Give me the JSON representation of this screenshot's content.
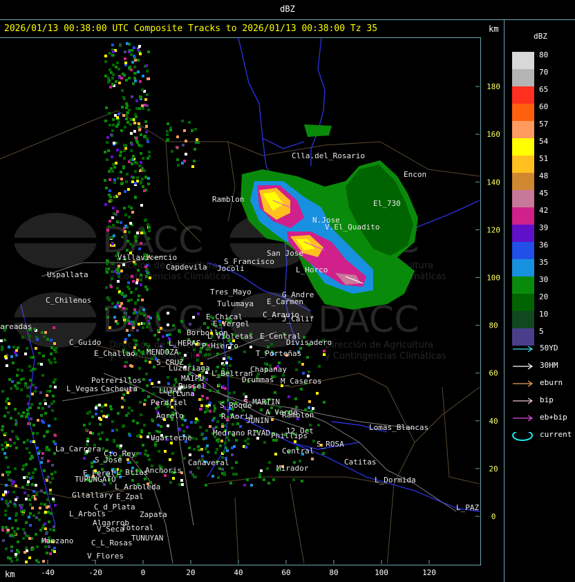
{
  "header": {
    "title": "dBZ"
  },
  "headline": "2026/01/13 00:38:00 UTC Composite Tracks to 2026/01/13 00:38:00 Tz 35",
  "units": {
    "km_top": "km",
    "km_bottom": "km"
  },
  "axes": {
    "x_ticks": [
      "-40",
      "-20",
      "0",
      "20",
      "40",
      "60",
      "80",
      "100",
      "120"
    ],
    "y_ticks": [
      "180",
      "160",
      "140",
      "120",
      "100",
      "80",
      "60",
      "40",
      "20",
      "0"
    ]
  },
  "legend": {
    "title": "dBZ",
    "bins": [
      {
        "label": "80",
        "color": "#d8d8d8"
      },
      {
        "label": "70",
        "color": "#b4b4b4"
      },
      {
        "label": "65",
        "color": "#ff3020"
      },
      {
        "label": "60",
        "color": "#ff6010"
      },
      {
        "label": "57",
        "color": "#ff9a60"
      },
      {
        "label": "54",
        "color": "#ffff00"
      },
      {
        "label": "51",
        "color": "#ffc020"
      },
      {
        "label": "48",
        "color": "#d08830"
      },
      {
        "label": "45",
        "color": "#c87898"
      },
      {
        "label": "42",
        "color": "#d0208c"
      },
      {
        "label": "39",
        "color": "#6010c8"
      },
      {
        "label": "36",
        "color": "#2050e8"
      },
      {
        "label": "35",
        "color": "#1890e0"
      },
      {
        "label": "30",
        "color": "#0a8a0a"
      },
      {
        "label": "20",
        "color": "#006400"
      },
      {
        "label": "10",
        "color": "#104820"
      },
      {
        "label": "5",
        "color": "#4a3e8c"
      }
    ],
    "tracks": [
      {
        "label": "50YD",
        "color": "#40e0f0",
        "kind": "arrow"
      },
      {
        "label": "30HM",
        "color": "#ffffff",
        "kind": "arrow"
      },
      {
        "label": "eburn",
        "color": "#e8a860",
        "kind": "arrow"
      },
      {
        "label": "bip",
        "color": "#f0c8d0",
        "kind": "arrow"
      },
      {
        "label": "eb+bip",
        "color": "#e050e0",
        "kind": "arrow"
      },
      {
        "label": "current",
        "color": "#20e8f0",
        "kind": "ellipse"
      }
    ]
  },
  "places": [
    "Clla.del_Rosario",
    "Encon",
    "Ramblon",
    "El_730",
    "N.Jose",
    "V.El_Quadito",
    "San Jose",
    "L_Horco",
    "S_Francisco",
    "Jocoli",
    "Capdevila",
    "Villavicencio",
    "Uspallata",
    "C_Chilenos",
    "Tres_Mayo",
    "Tulumaya",
    "G_Andre",
    "E_Carmen",
    "E_Chical",
    "E_Vergel",
    "C_Araujo",
    "J_Calif",
    "Borbollon",
    "L_Violetas",
    "E_Central",
    "Divisadero",
    "L_HERAS",
    "P_Hierro",
    "C_Guido",
    "E_Challao",
    "MENDOZA",
    "T_Porteñas",
    "S_CRUZ",
    "Luzuriaga",
    "Chapanay",
    "L_Beltran",
    "Russel",
    "MAIPU",
    "Drummas",
    "M_Caseros",
    "Potrerillos",
    "Cacheuta",
    "L_Vegas",
    "LUJAN",
    "C_Luna",
    "Perdriel",
    "S_Roque",
    "S_MARTIN",
    "A_Verde",
    "Ramblon",
    "Agrelo",
    "JUNIN",
    "R_Aoria",
    "Ugarteche",
    "RIVAD",
    "Phillips",
    "12_Oct",
    "Lomas_Blancas",
    "La_Carrera",
    "Cto_Rey",
    "S_Jose",
    "Cañaveral",
    "Medrano",
    "Central",
    "S_ROSA",
    "Catitas",
    "E_Peral",
    "TUPUNGATO",
    "L_Btias",
    "Anchoris",
    "Mirador",
    "L_Dormida",
    "L_Arboleda",
    "Gltallary",
    "E_Zpal",
    "C_d_Plata",
    "Zapata",
    "L_Arbols",
    "Algarrob",
    "V_Seca",
    "Totoral",
    "TUNUYAN",
    "Manzano",
    "C_L_Rosas",
    "V_Flores",
    "L_PAZ",
    "areadas"
  ],
  "watermark": {
    "brand": "DACC",
    "line1": "Dirección de Agricultura",
    "line2": "y Contingencias Climáticas"
  }
}
